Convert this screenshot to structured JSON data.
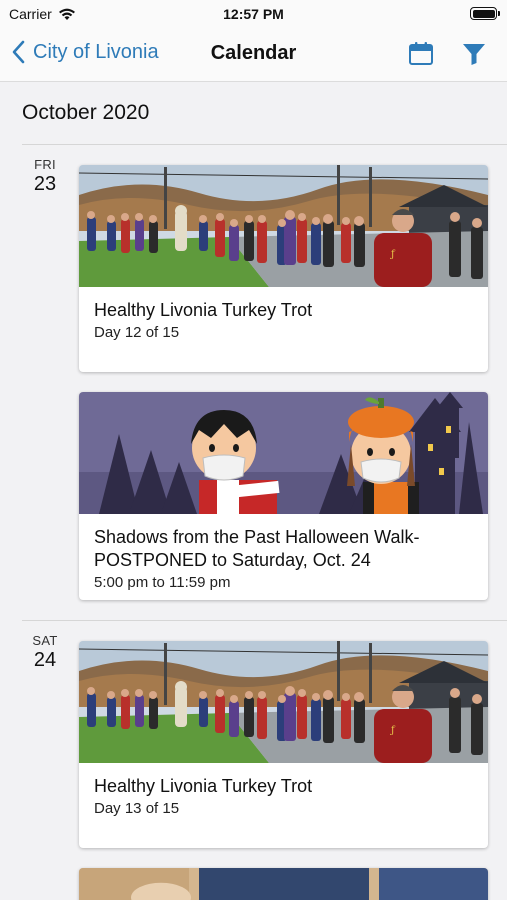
{
  "status_bar": {
    "carrier": "Carrier",
    "time": "12:57 PM"
  },
  "nav": {
    "back_label": "City of Livonia",
    "title": "Calendar"
  },
  "month": "October 2020",
  "days": [
    {
      "day_name": "FRI",
      "day_num": "23",
      "events": [
        {
          "title": "Healthy Livonia Turkey Trot",
          "subtitle": "Day 12 of 15",
          "image": "crowd-walking-photo"
        },
        {
          "title": "Shadows from the Past Halloween Walk- POSTPONED to Saturday, Oct. 24",
          "subtitle": "5:00 pm to 11:59 pm",
          "image": "halloween-masked-kids-illustration"
        }
      ]
    },
    {
      "day_name": "SAT",
      "day_num": "24",
      "events": [
        {
          "title": "Healthy Livonia Turkey Trot",
          "subtitle": "Day 13 of 15",
          "image": "crowd-walking-photo"
        },
        {
          "title": "",
          "subtitle": "",
          "image": "partial-photo"
        }
      ]
    }
  ],
  "colors": {
    "accent": "#2e7bb8",
    "background": "#f2f2f4",
    "card": "#ffffff"
  },
  "icons": {
    "wifi": "wifi-icon",
    "battery": "battery-icon",
    "back": "chevron-left-icon",
    "calendar": "calendar-icon",
    "filter": "filter-icon"
  }
}
